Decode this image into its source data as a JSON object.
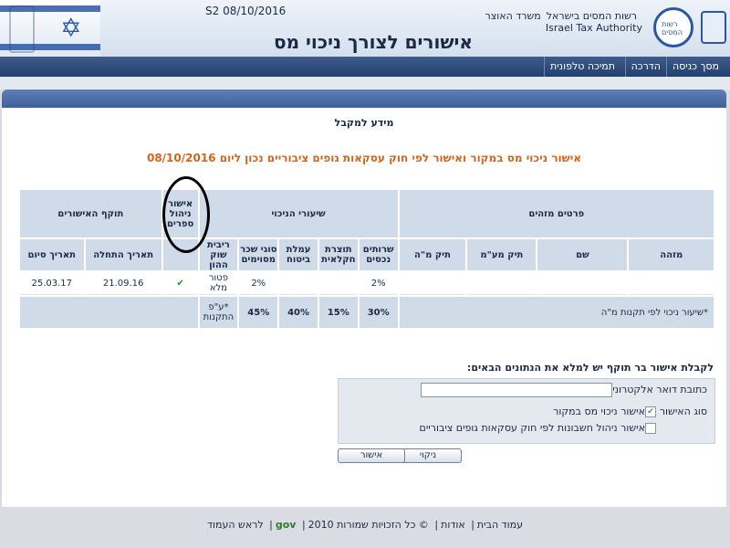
{
  "header": {
    "date": "S2 08/10/2016",
    "page_title": "אישורים לצורך ניכוי מס",
    "org_he": "רשות המסים בישראל",
    "ministry_he": "משרד האוצר",
    "org_en": "Israel Tax Authority",
    "logo_text": "רשות המסים"
  },
  "nav": {
    "items": [
      "מסך כניסה",
      "הדרכה",
      "תמיכה טלפונית"
    ]
  },
  "content": {
    "subtitle": "מידע למקבל",
    "heading": "אישור ניכוי מס במקור ואישור לפי חוק עסקאות גופים ציבוריים נכון ליום 08/10/2016"
  },
  "table": {
    "groups": {
      "identifiers": "פרטים מזהים",
      "rates": "שיעורי הניכוי",
      "bookkeeping": "אישור ניהול ספרים",
      "validity": "תוקף האישורים"
    },
    "columns": {
      "id": "מזהה",
      "name": "שם",
      "vat_file": "תיק מע\"מ",
      "tax_file": "תיק מ\"ה",
      "services": "שרותים נכסים",
      "agri": "תוצרת חקלאית",
      "insurance": "עמלת ביטוח",
      "royalties": "סוגי שכר מסוימים",
      "interest": "ריבית שוק ההון",
      "start": "תאריך התחלה",
      "end": "תאריך סיום"
    },
    "row": {
      "services": "2%",
      "agri": "",
      "insurance": "",
      "royalties": "2%",
      "interest": "פטור מלא",
      "bookkeeping": "✔",
      "start": "21.09.16",
      "end": "25.03.17"
    },
    "rate_row": {
      "label": "*שיעור ניכוי לפי תקנות מ\"ה",
      "services": "30%",
      "agri": "15%",
      "insurance": "40%",
      "royalties": "45%",
      "interest": "*ע\"פ התקנות"
    }
  },
  "form": {
    "title": "לקבלת אישור בר תוקף יש למלא את הנתונים הבאים:",
    "email_label": "כתובת דואר אלקטרוני",
    "email_value": "",
    "type_label": "סוג האישור",
    "option1": "אישור ניכוי מס במקור",
    "option1_checked": true,
    "option2": "אישור ניהול חשבונות לפי חוק עסקאות גופים ציבוריים",
    "option2_checked": false,
    "clear_button": "ניקוי",
    "approve_button": "אישור"
  },
  "footer": {
    "home": "עמוד הבית",
    "about": "אודות",
    "copyright": "© כל הזכויות שמורות 2010",
    "gov": "gov",
    "top": "לראש העמוד"
  }
}
